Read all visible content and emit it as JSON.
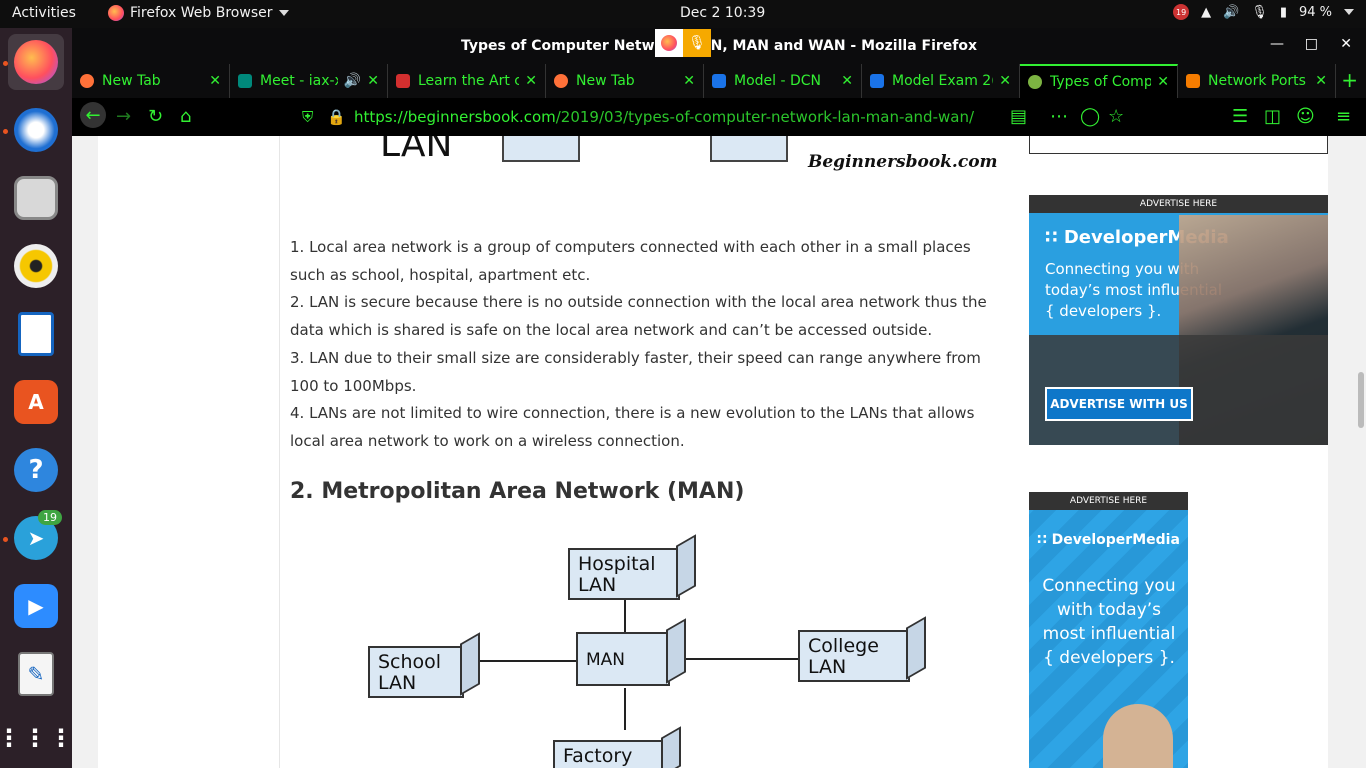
{
  "topbar": {
    "activities": "Activities",
    "app_name": "Firefox Web Browser",
    "clock": "Dec 2  10:39",
    "battery": "94 %",
    "notif_count": "19"
  },
  "dock": {
    "telegram_badge": "19"
  },
  "window": {
    "title": "Types of Computer Network: LAN, MAN and WAN - Mozilla Firefox"
  },
  "tabs": [
    {
      "label": "New Tab",
      "icon_color": "#ff7139"
    },
    {
      "label": "Meet - iax-x",
      "icon_color": "#00897b"
    },
    {
      "label": "Learn the Art c",
      "icon_color": "#d32f2f"
    },
    {
      "label": "New Tab",
      "icon_color": "#ff7139"
    },
    {
      "label": "Model - DCN",
      "icon_color": "#1a73e8"
    },
    {
      "label": "Model Exam 2(",
      "icon_color": "#1a73e8"
    },
    {
      "label": "Types of Comp",
      "icon_color": "#7cb342"
    },
    {
      "label": "Network Ports",
      "icon_color": "#f57c00"
    }
  ],
  "navbar": {
    "url_host": "https://beginnersbook.com",
    "url_path": "/2019/03/types-of-computer-network-lan-man-and-wan/"
  },
  "content": {
    "top_diagram_label": "LAN",
    "watermark": "Beginnersbook.com",
    "lan_points": [
      "1. Local area network is a group of computers connected with each other in a small places such as school, hospital, apartment etc.",
      "2. LAN is secure because there is no outside connection with the local area network thus the data which is shared is safe on the local area network and can’t be accessed outside.",
      "3. LAN due to their small size are considerably faster, their speed can range anywhere from 100 to 100Mbps.",
      "4. LANs are not limited to wire connection, there is a new evolution to the LANs that allows local area network to work on a wireless connection."
    ],
    "man_heading": "2. Metropolitan Area Network (MAN)",
    "man_diagram": {
      "hospital": "Hospital LAN",
      "school": "School LAN",
      "center": "MAN",
      "college": "College LAN",
      "factory": "Factory"
    }
  },
  "ads": {
    "ad1": {
      "header": "ADVERTISE HERE",
      "brand": "DeveloperMedia",
      "message": "Connecting you with today’s most influential { developers }.",
      "button": "ADVERTISE WITH US"
    },
    "ad2": {
      "header": "ADVERTISE HERE",
      "brand": "DeveloperMedia",
      "message": "Connecting you with today’s most influential { developers }."
    }
  },
  "colors": {
    "accent_green": "#32f032",
    "ubuntu_orange": "#e95420",
    "ad_blue": "#2a9fe0"
  }
}
